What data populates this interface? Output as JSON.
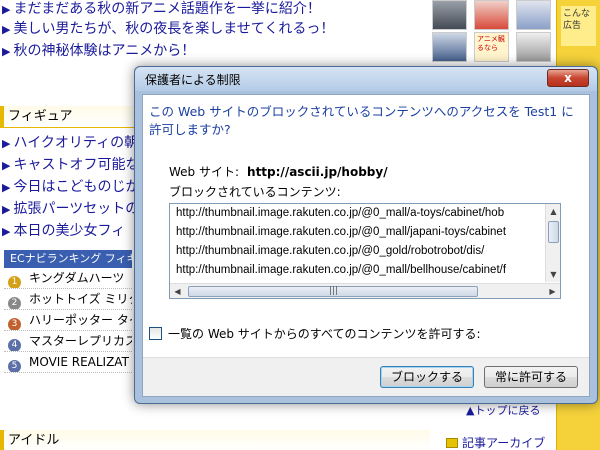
{
  "page": {
    "headlines_top": [
      "まだまだある秋の新アニメ話題作を一挙に紹介！",
      "美しい男たちが、秋の夜長を楽しませてくれるっ！",
      "秋の神秘体験はアニメから！"
    ],
    "figure_section": "フィギュア",
    "figure_links": [
      "ハイクオリティの朝",
      "キャストオフ可能な",
      "今日はこどものじか",
      "拡張パーツセットの",
      "本日の美少女フィ"
    ],
    "ranking_title": "ECナビランキング フィギ",
    "ranking_items": [
      {
        "num": "1",
        "label": "キングダムハーツ"
      },
      {
        "num": "2",
        "label": "ホットトイズ ミリタリ"
      },
      {
        "num": "3",
        "label": "ハリーポッター タイ"
      },
      {
        "num": "4",
        "label": "マスターレプリカス"
      },
      {
        "num": "5",
        "label": "MOVIE REALIZAT"
      }
    ],
    "top_link": "▲トップに戻る",
    "idol_section": "アイドル",
    "archive_link": "記事アーカイブ",
    "thumb_ad_text": "アニメ観るなら",
    "side_ad_text": "こんな広告"
  },
  "dialog": {
    "title": "保護者による制限",
    "close_label": "x",
    "prompt": "この Web サイトのブロックされているコンテンツへのアクセスを Test1 に許可しますか?",
    "site_label": "Web サイト:",
    "site_url": "http://ascii.jp/hobby/",
    "blocked_label": "ブロックされているコンテンツ:",
    "blocked_items": [
      "http://thumbnail.image.rakuten.co.jp/@0_mall/a-toys/cabinet/hob",
      "http://thumbnail.image.rakuten.co.jp/@0_mall/japani-toys/cabinet",
      "http://thumbnail.image.rakuten.co.jp/@0_gold/robotrobot/dis/",
      "http://thumbnail.image.rakuten.co.jp/@0_mall/bellhouse/cabinet/f"
    ],
    "allow_all_label": "一覧の Web サイトからのすべてのコンテンツを許可する:",
    "block_button": "ブロックする",
    "always_allow_button": "常に許可する"
  },
  "colors": {
    "dialog_frame": "#a9c1dd",
    "prompt_text": "#1b3fa0",
    "link_text": "#1a1a9a",
    "accent_yellow": "#f5d23a"
  }
}
